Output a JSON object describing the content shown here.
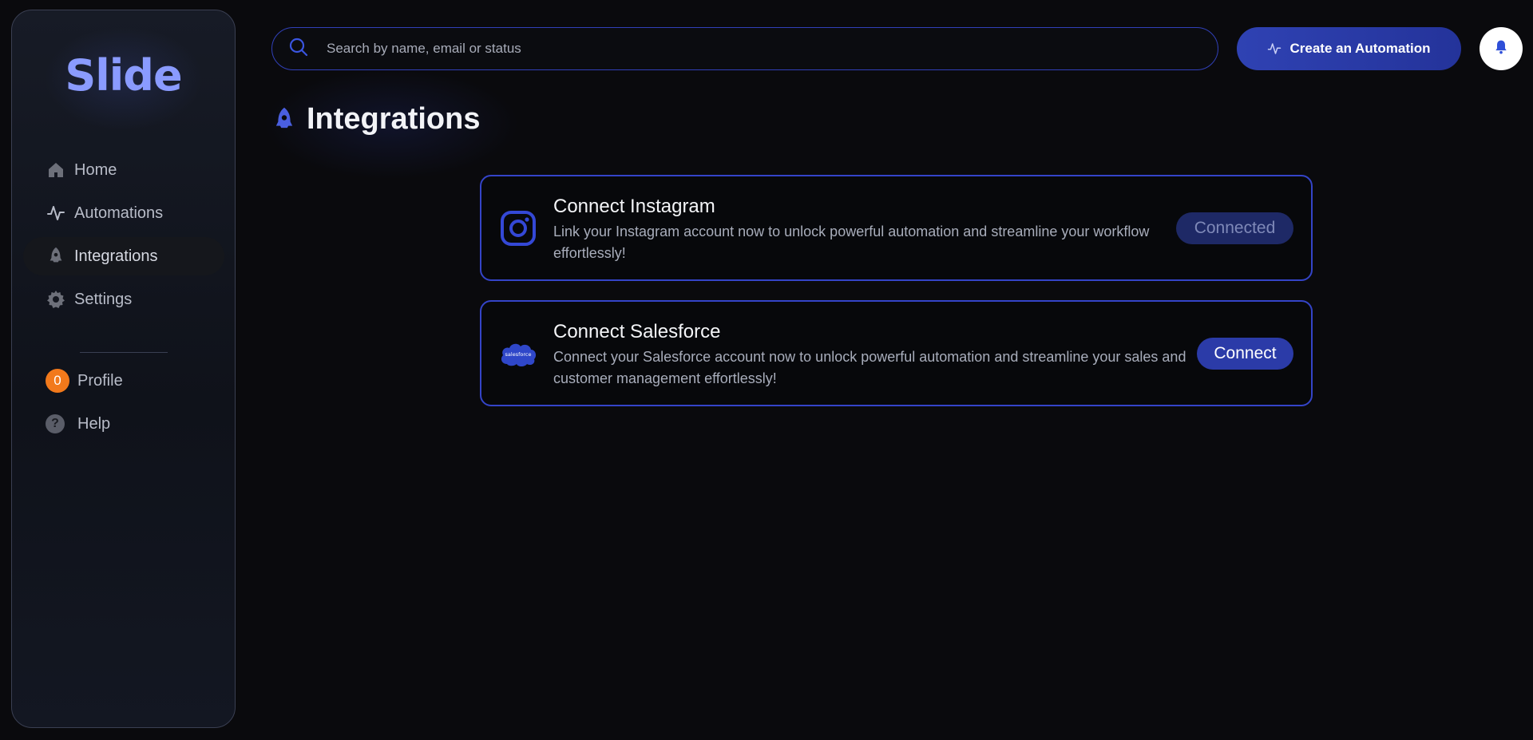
{
  "sidebar": {
    "logo": "Slide",
    "nav": [
      {
        "label": "Home",
        "icon": "home-icon"
      },
      {
        "label": "Automations",
        "icon": "activity-icon"
      },
      {
        "label": "Integrations",
        "icon": "rocket-icon",
        "active": true
      },
      {
        "label": "Settings",
        "icon": "gear-icon"
      }
    ],
    "profile": {
      "label": "Profile",
      "avatar_initial": "0",
      "avatar_color": "#f2791b"
    },
    "help": {
      "label": "Help",
      "icon": "help-icon"
    }
  },
  "header": {
    "search_placeholder": "Search by name, email or status",
    "create_button_label": "Create an Automation",
    "accent_color": "#2f42b3"
  },
  "page": {
    "title": "Integrations",
    "title_icon": "rocket-icon"
  },
  "integrations": [
    {
      "title": "Connect Instagram",
      "description": "Link your Instagram account now to unlock powerful automation and streamline your workflow effortlessly!",
      "status_label": "Connected",
      "icon": "instagram-icon"
    },
    {
      "title": "Connect Salesforce",
      "description": "Connect your Salesforce account now to unlock powerful automation and streamline your sales and customer management effortlessly!",
      "status_label": "Connect",
      "icon": "salesforce-icon",
      "icon_text": "salesforce"
    }
  ]
}
